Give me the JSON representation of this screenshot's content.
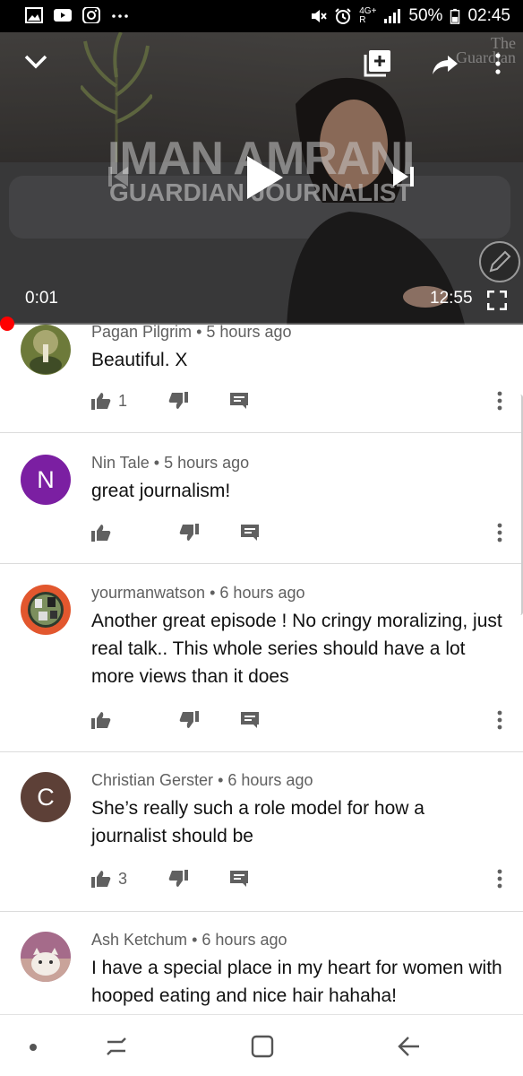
{
  "status_bar": {
    "left_icons": [
      "gallery-icon",
      "youtube-icon",
      "instagram-icon",
      "more-dots-icon"
    ],
    "network": "4G+",
    "roaming": "R",
    "battery": "50%",
    "time": "02:45"
  },
  "player": {
    "overlay_title": "IMAN AMRANI",
    "overlay_subtitle": "GUARDIAN JOURNALIST",
    "watermark_line1": "The",
    "watermark_line2": "Guardian",
    "elapsed": "0:01",
    "duration": "12:55",
    "progress": 0.001
  },
  "comments": [
    {
      "author": "Pagan Pilgrim",
      "age": "5 hours ago",
      "text": "Beautiful. X",
      "likes": "1",
      "avatar_letter": "",
      "avatar_color": "#6d7a3a"
    },
    {
      "author": "Nin Tale",
      "age": "5 hours ago",
      "text": "great journalism!",
      "likes": "",
      "avatar_letter": "N",
      "avatar_color": "#7b1fa2"
    },
    {
      "author": "yourmanwatson",
      "age": "6 hours ago",
      "text": "Another great episode ! No cringy moralizing, just real talk.. This whole series should have a lot more views than it does",
      "likes": "",
      "avatar_letter": "",
      "avatar_color": "#e2572e"
    },
    {
      "author": "Christian Gerster",
      "age": "6 hours ago",
      "text": "She’s really such a role model for how a journalist should be",
      "likes": "3",
      "avatar_letter": "C",
      "avatar_color": "#5d4037"
    },
    {
      "author": "Ash Ketchum",
      "age": "6 hours ago",
      "text": "I have a special place in my heart for women with hooped eating and nice hair hahaha!",
      "likes": "",
      "avatar_letter": "",
      "avatar_color": "#a56b8a"
    }
  ],
  "separator": "•"
}
